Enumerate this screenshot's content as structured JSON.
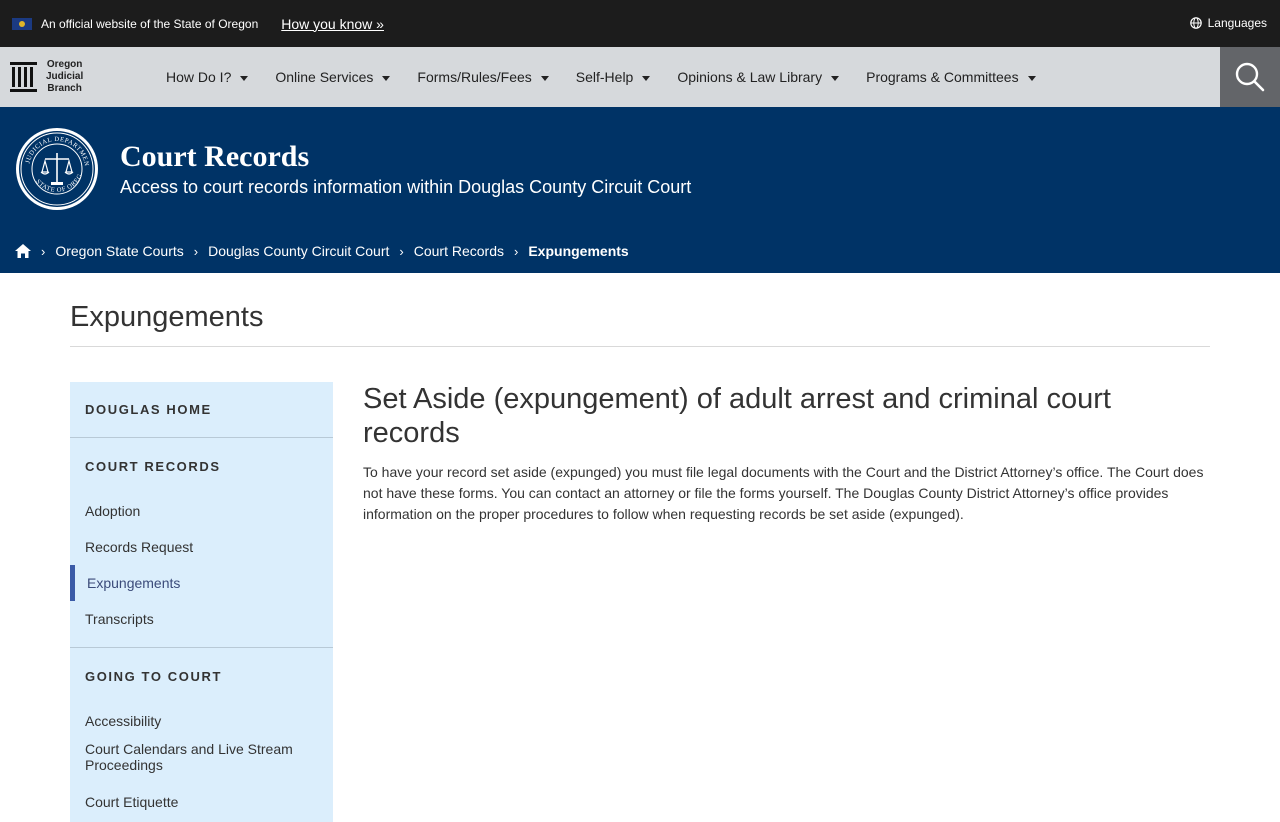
{
  "banner": {
    "official_text": "An official website of the State of Oregon",
    "how_link": "How you know »",
    "languages": "Languages"
  },
  "logo": {
    "line1": "Oregon",
    "line2": "Judicial",
    "line3": "Branch"
  },
  "nav": {
    "items": [
      {
        "label": "How Do I?"
      },
      {
        "label": "Online Services"
      },
      {
        "label": "Forms/Rules/Fees"
      },
      {
        "label": "Self-Help"
      },
      {
        "label": "Opinions & Law Library"
      },
      {
        "label": "Programs & Committees"
      }
    ]
  },
  "hero": {
    "title": "Court Records",
    "subtitle": "Access to court records information within Douglas County Circuit Court"
  },
  "breadcrumb": {
    "items": [
      "Oregon State Courts",
      "Douglas County Circuit Court",
      "Court Records"
    ],
    "current": "Expungements"
  },
  "page": {
    "title": "Expungements"
  },
  "sidebar": {
    "home": "DOUGLAS HOME",
    "sections": [
      {
        "title": "COURT RECORDS",
        "links": [
          "Adoption",
          "Records Request",
          "Expungements",
          "Transcripts"
        ]
      },
      {
        "title": "GOING TO COURT",
        "links": [
          "Accessibility",
          "Court Calendars and Live Stream Proceedings",
          "Court Etiquette"
        ]
      }
    ]
  },
  "article": {
    "heading": "Set Aside (expungement) of adult arrest and criminal court records",
    "body": "To have your record set aside (expunged) you must file legal documents with the Court and the District Attorney’s office. The Court does not have these forms. You can contact an attorney or file the forms yourself. The Douglas County District Attorney’s office provides information on the proper procedures to follow when requesting records be set aside (expunged)."
  },
  "colors": {
    "banner_bg": "#1c1c1c",
    "nav_bg": "#d6d9dc",
    "hero_bg": "#003366",
    "sidebar_bg": "#dbeefc",
    "active_accent": "#3b5ba7"
  }
}
